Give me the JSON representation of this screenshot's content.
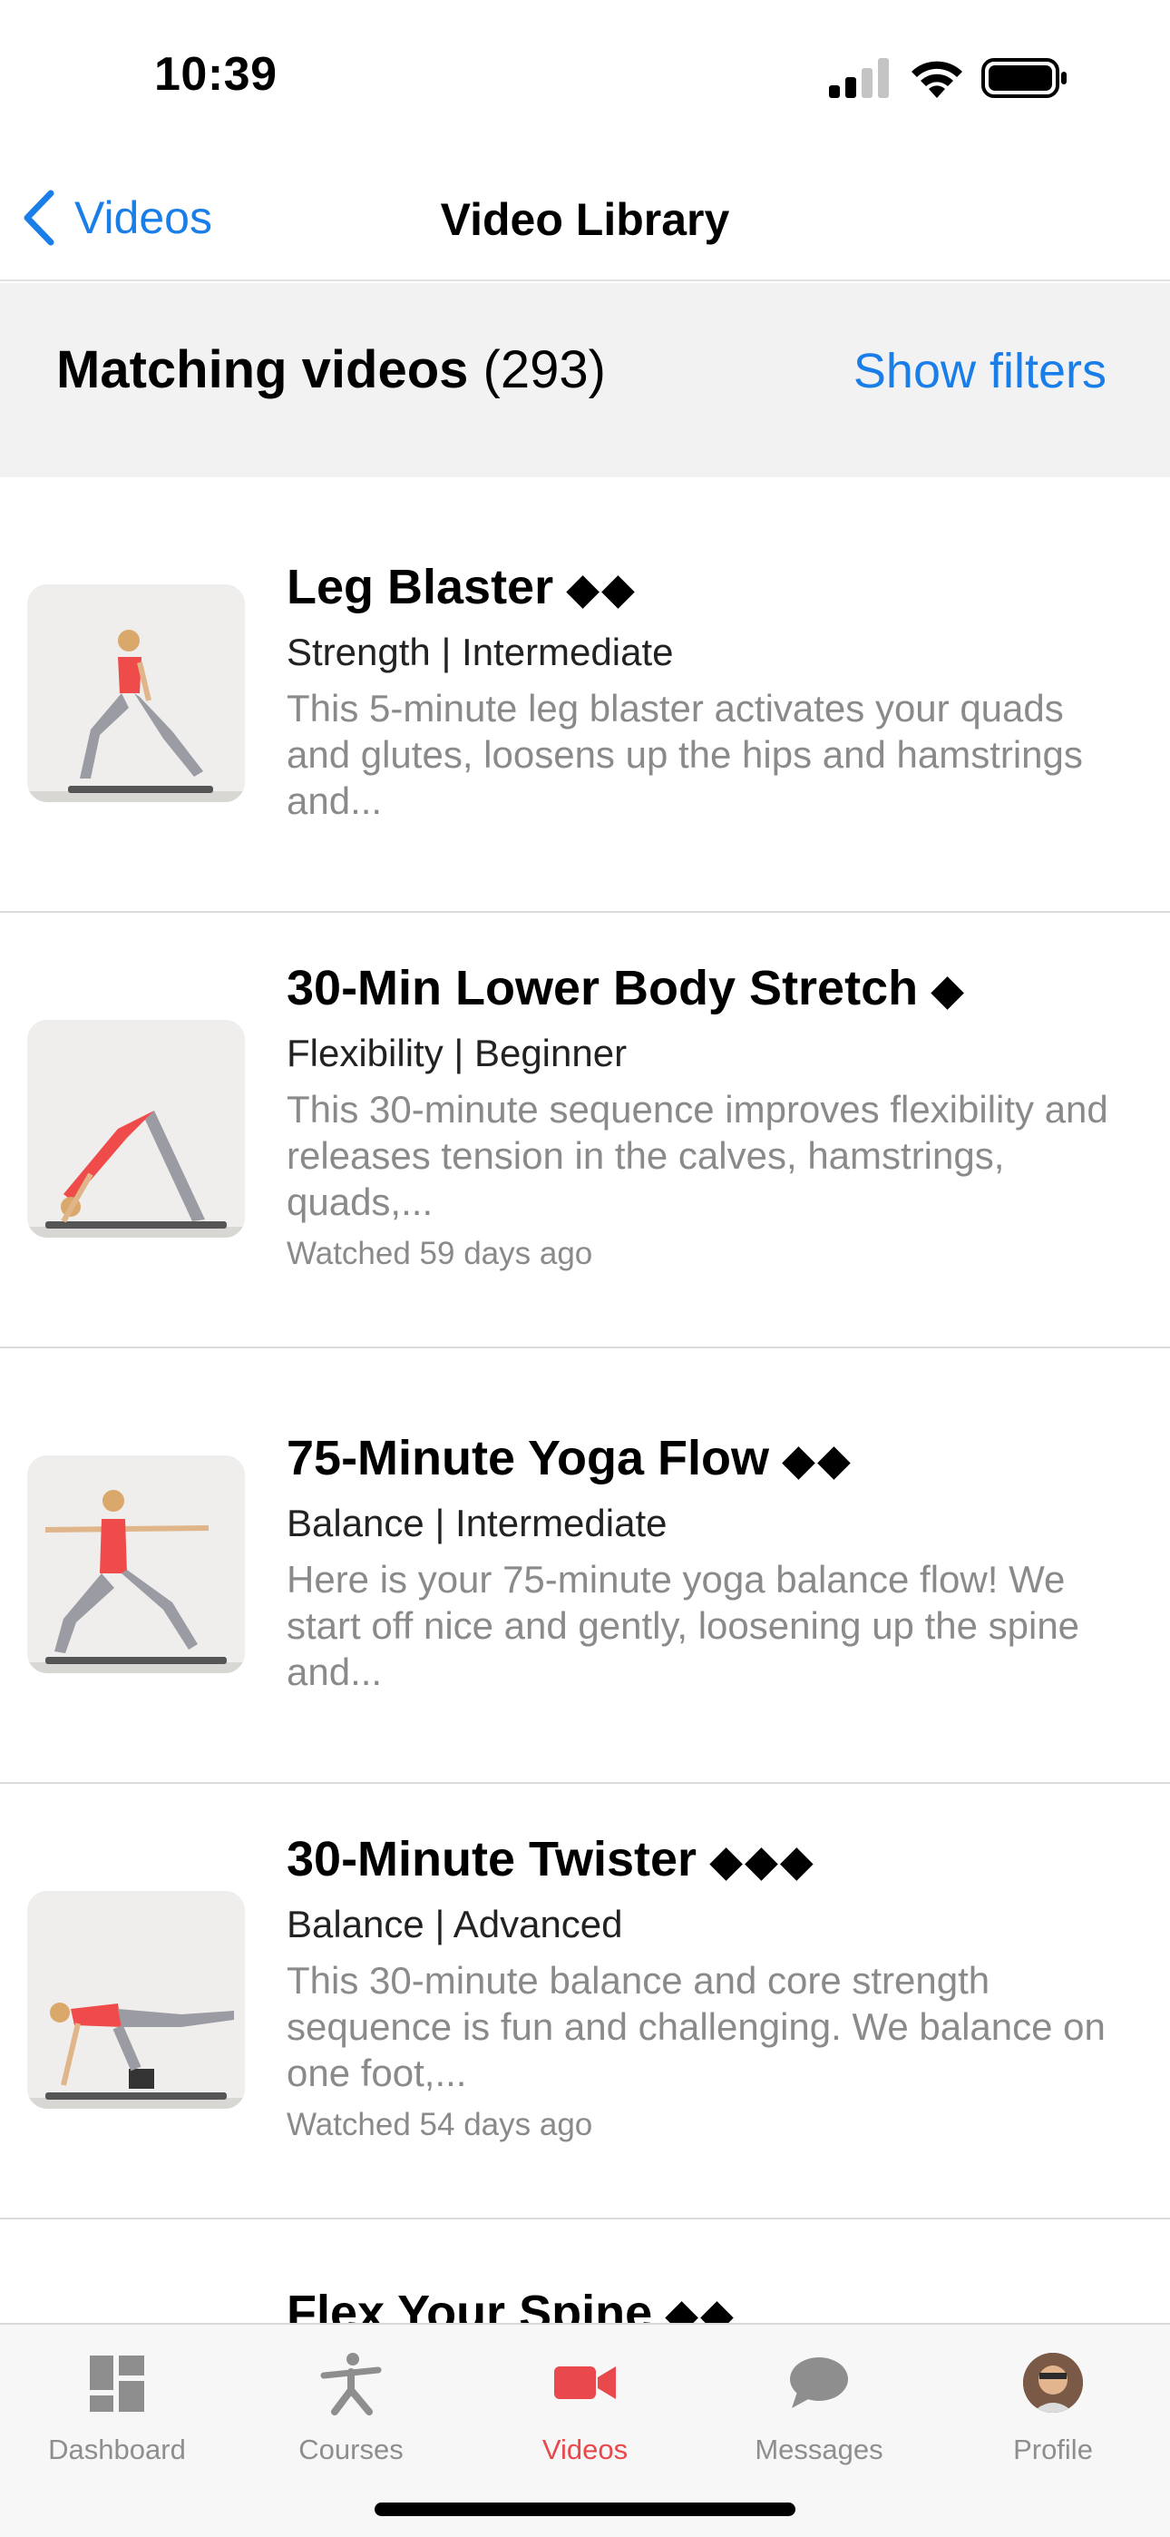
{
  "status_bar": {
    "time": "10:39"
  },
  "nav": {
    "back_label": "Videos",
    "title": "Video Library"
  },
  "filter_header": {
    "label": "Matching videos",
    "count": "(293)",
    "show_filters": "Show filters"
  },
  "videos": [
    {
      "title": "Leg Blaster",
      "diamonds": "◆◆",
      "meta": "Strength | Intermediate",
      "description": "This 5-minute leg blaster activates your quads and glutes, loosens up the hips and hamstrings and...",
      "watched": ""
    },
    {
      "title": "30-Min Lower Body Stretch",
      "diamonds": "◆",
      "meta": "Flexibility | Beginner",
      "description": "This 30-minute sequence improves flexibility and releases tension in the calves, hamstrings, quads,...",
      "watched": "Watched 59 days ago"
    },
    {
      "title": "75-Minute Yoga Flow",
      "diamonds": "◆◆",
      "meta": "Balance | Intermediate",
      "description": "Here is your 75-minute yoga balance flow! We start off nice and gently, loosening up the spine and...",
      "watched": ""
    },
    {
      "title": "30-Minute Twister",
      "diamonds": "◆◆◆",
      "meta": "Balance | Advanced",
      "description": "This 30-minute balance and core strength sequence is fun and challenging. We balance on one foot,...",
      "watched": "Watched 54 days ago"
    },
    {
      "title": "Flex Your Spine",
      "diamonds": "◆◆"
    }
  ],
  "tabs": [
    {
      "label": "Dashboard",
      "icon": "dashboard-icon"
    },
    {
      "label": "Courses",
      "icon": "person-stretch-icon"
    },
    {
      "label": "Videos",
      "icon": "video-camera-icon",
      "active": true
    },
    {
      "label": "Messages",
      "icon": "chat-bubble-icon"
    },
    {
      "label": "Profile",
      "icon": "avatar"
    }
  ],
  "colors": {
    "accent_blue": "#1a7ee8",
    "active_red": "#e9484d",
    "tab_gray": "#8e8e8e",
    "header_bg": "#f2f2f2"
  }
}
